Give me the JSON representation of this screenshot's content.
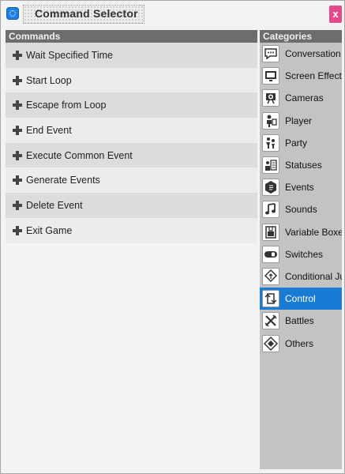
{
  "window": {
    "title": "Command Selector",
    "close_label": "x"
  },
  "commands": {
    "header": "Commands",
    "items": [
      {
        "label": "Wait Specified Time"
      },
      {
        "label": "Start Loop"
      },
      {
        "label": "Escape from Loop"
      },
      {
        "label": "End Event"
      },
      {
        "label": "Execute Common Event"
      },
      {
        "label": "Generate Events"
      },
      {
        "label": "Delete Event"
      },
      {
        "label": "Exit Game"
      }
    ]
  },
  "categories": {
    "header": "Categories",
    "selected": "Control",
    "items": [
      {
        "label": "Conversation",
        "icon": "speech-bubble-icon"
      },
      {
        "label": "Screen Effects",
        "icon": "monitor-icon"
      },
      {
        "label": "Cameras",
        "icon": "camera-icon"
      },
      {
        "label": "Player",
        "icon": "player-icon"
      },
      {
        "label": "Party",
        "icon": "party-icon"
      },
      {
        "label": "Statuses",
        "icon": "statuses-icon"
      },
      {
        "label": "Events",
        "icon": "events-icon"
      },
      {
        "label": "Sounds",
        "icon": "music-note-icon"
      },
      {
        "label": "Variable Boxe",
        "icon": "variable-box-icon"
      },
      {
        "label": "Switches",
        "icon": "toggle-switch-icon"
      },
      {
        "label": "Conditional Ju",
        "icon": "conditional-jump-icon"
      },
      {
        "label": "Control",
        "icon": "control-loop-icon"
      },
      {
        "label": "Battles",
        "icon": "crossed-swords-icon"
      },
      {
        "label": "Others",
        "icon": "others-diamond-icon"
      }
    ]
  },
  "colors": {
    "header_bg": "#6d6d6d",
    "selected_bg": "#1a7bd4",
    "close_bg": "#e44a8b",
    "app_icon": "#1f7fe0"
  }
}
